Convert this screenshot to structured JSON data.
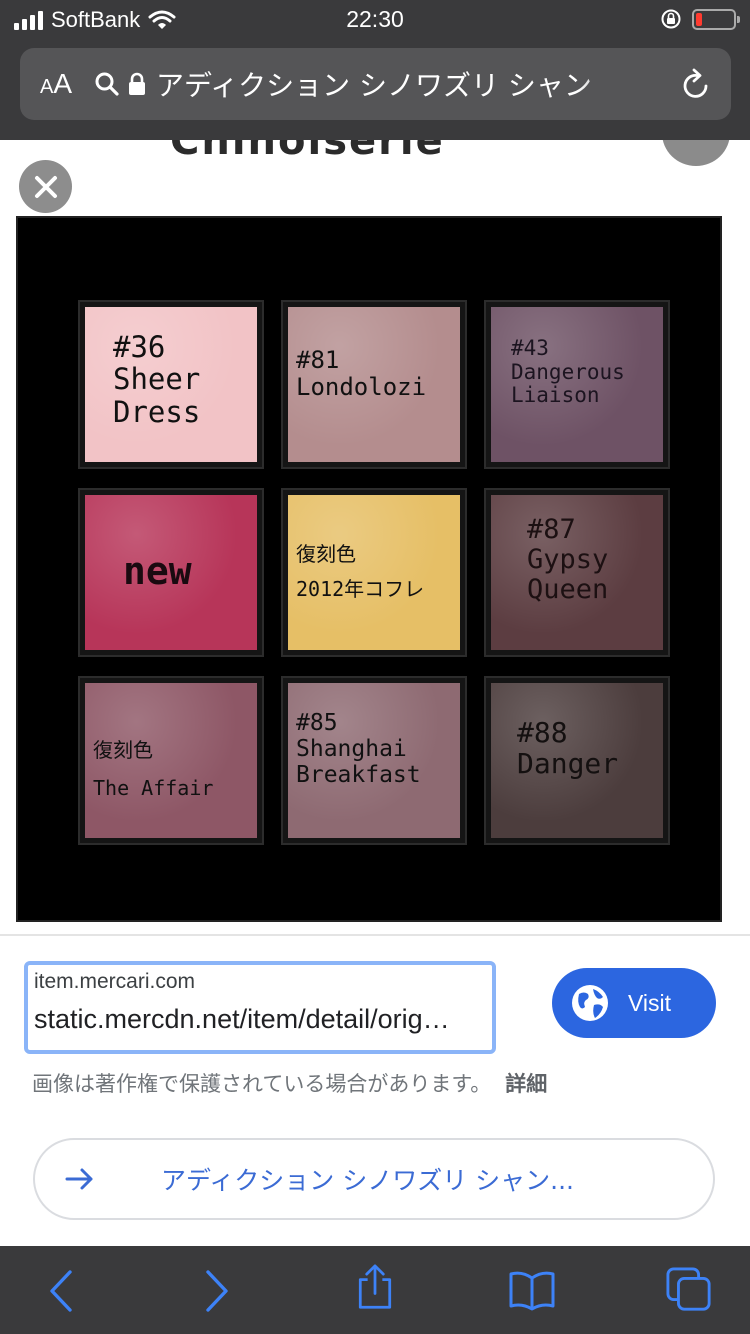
{
  "status_bar": {
    "carrier": "SoftBank",
    "time": "22:30"
  },
  "url_bar": {
    "text_size_small": "A",
    "text_size_large": "A",
    "page_title": "アディクション シノワズリ シャン"
  },
  "viewer": {
    "peek_title": "Chinoiserie"
  },
  "palette": {
    "pans": [
      {
        "color": "#f2c3c6",
        "label": "#36\nSheer\nDress"
      },
      {
        "color": "#b48d8e",
        "label": "#81\nLondolozi"
      },
      {
        "color": "#6e5265",
        "label": "#43\nDangerous\nLiaison"
      },
      {
        "color": "#b73559",
        "label": "new"
      },
      {
        "color": "#e6bf66",
        "label": "復刻色\n2012年コフレ"
      },
      {
        "color": "#5c3d41",
        "label": "#87\nGypsy\nQueen"
      },
      {
        "color": "#8e5766",
        "label": "復刻色\nThe Affair"
      },
      {
        "color": "#8e6a72",
        "label": "#85\nShanghai\nBreakfast"
      },
      {
        "color": "#4c3d3d",
        "label": "#88\nDanger"
      }
    ]
  },
  "source": {
    "domain": "item.mercari.com",
    "path": "static.mercdn.net/item/detail/orig…",
    "visit_label": "Visit"
  },
  "notice": {
    "text": "画像は著作権で保護されている場合があります。",
    "link": "詳細"
  },
  "related": {
    "text": "アディクション シノワズリ シャン..."
  },
  "colors": {
    "chrome": "#3a3a3c",
    "accent_blue": "#2c66e0",
    "link_blue": "#3b6bd4"
  }
}
